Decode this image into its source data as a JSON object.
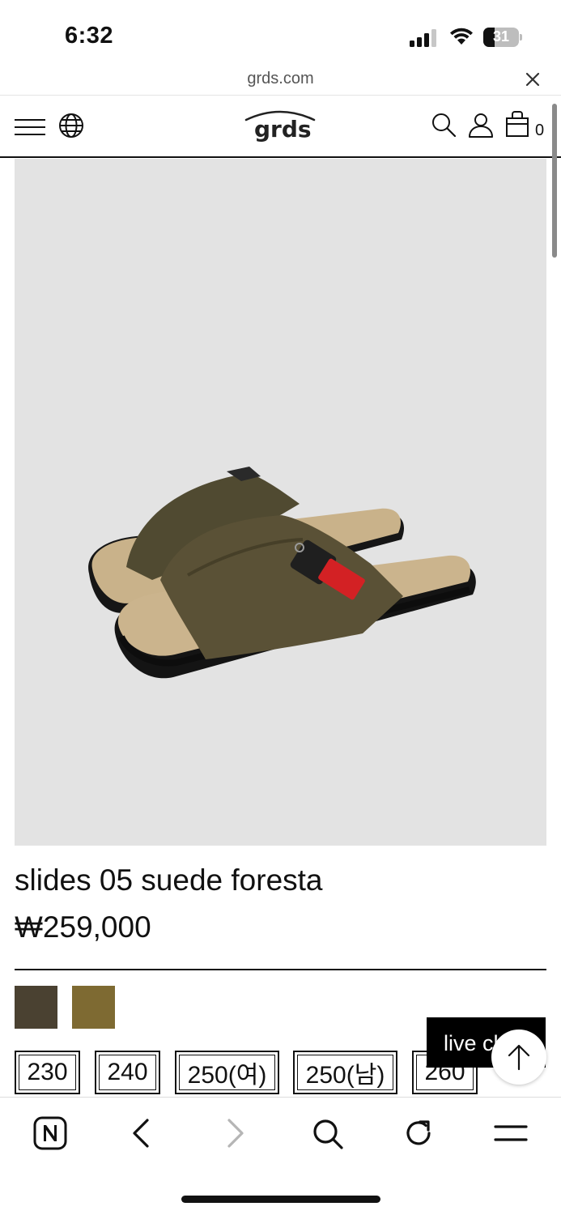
{
  "status_bar": {
    "time": "6:32",
    "battery_level": "31"
  },
  "browser": {
    "url": "grds.com"
  },
  "header": {
    "logo_text": "grds",
    "cart_count": "0",
    "icons": [
      "menu-icon",
      "globe-icon",
      "search-icon",
      "account-icon",
      "shopping-bag-icon"
    ]
  },
  "product": {
    "name": "slides 05 suede foresta",
    "price": "₩259,000",
    "colors": [
      {
        "hex": "#4a4131"
      },
      {
        "hex": "#7e6a32"
      }
    ],
    "sizes": [
      "230",
      "240",
      "250(여)",
      "250(남)",
      "260"
    ]
  },
  "live_chat": {
    "label": "live chat"
  },
  "toolbar": {
    "icons": [
      "naver-home-icon",
      "back-icon",
      "forward-icon",
      "search-icon",
      "refresh-icon",
      "menu-icon"
    ]
  }
}
